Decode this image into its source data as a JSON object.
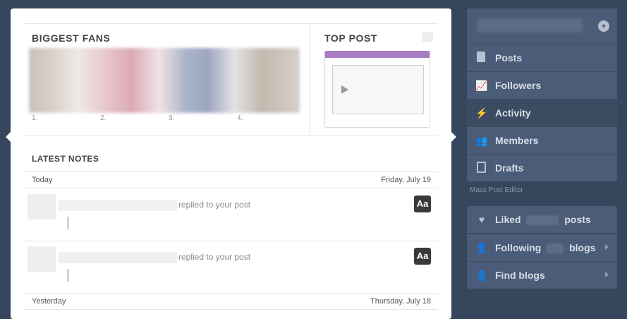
{
  "activity": {
    "biggest_fans": {
      "title": "BIGGEST FANS",
      "ranks": [
        "1.",
        "2.",
        "3.",
        "4."
      ]
    },
    "top_post": {
      "title": "TOP POST"
    },
    "latest_notes": {
      "title": "LATEST NOTES",
      "days": [
        {
          "label": "Today",
          "date": "Friday, July 19",
          "notes": [
            {
              "action": "replied to your post",
              "badge": "Aa"
            },
            {
              "action": "replied to your post",
              "badge": "Aa"
            }
          ]
        },
        {
          "label": "Yesterday",
          "date": "Thursday, July 18"
        }
      ]
    }
  },
  "sidebar": {
    "items": [
      {
        "label": "Posts",
        "icon": "posts-icon"
      },
      {
        "label": "Followers",
        "icon": "followers-icon"
      },
      {
        "label": "Activity",
        "icon": "activity-icon",
        "active": true
      },
      {
        "label": "Members",
        "icon": "members-icon"
      },
      {
        "label": "Drafts",
        "icon": "drafts-icon"
      }
    ],
    "mass_post_editor": "Mass Post Editor",
    "secondary": [
      {
        "prefix": "Liked",
        "suffix": "posts",
        "icon": "heart-icon"
      },
      {
        "prefix": "Following",
        "suffix": "blogs",
        "icon": "person-icon"
      },
      {
        "prefix": "Find blogs",
        "icon": "add-person-icon"
      }
    ]
  }
}
